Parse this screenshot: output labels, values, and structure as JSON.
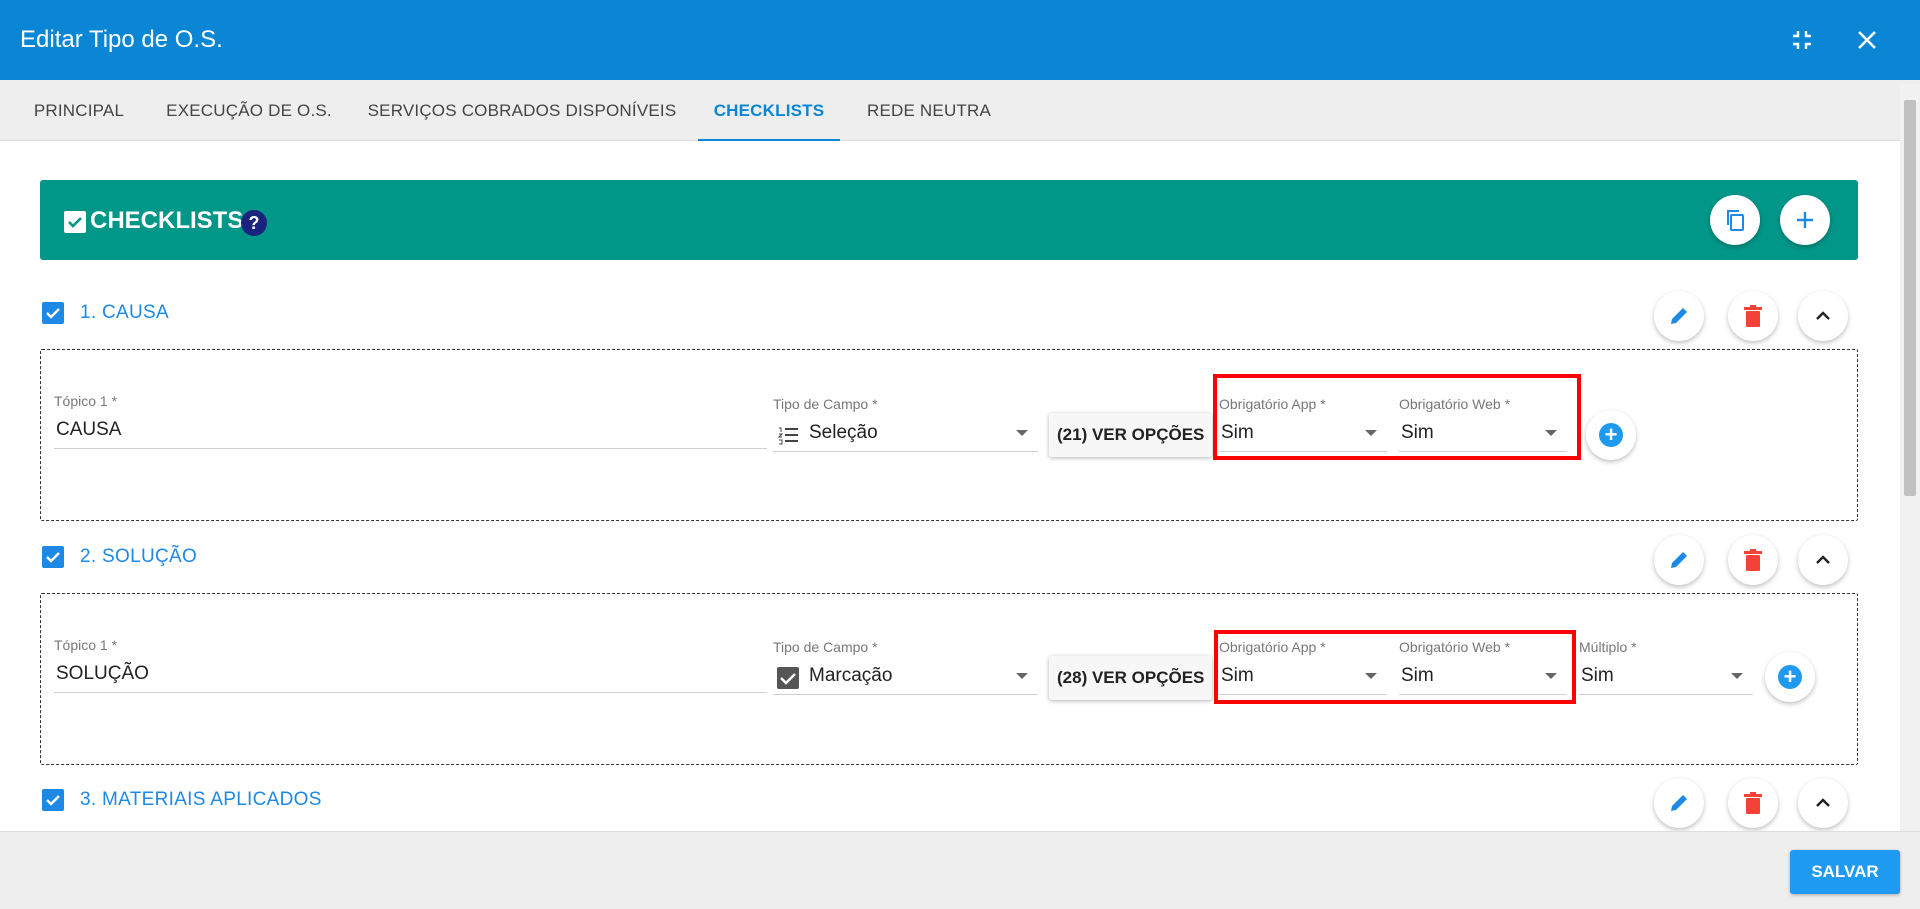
{
  "window": {
    "title": "Editar Tipo de O.S."
  },
  "tabs": [
    {
      "label": "PRINCIPAL"
    },
    {
      "label": "EXECUÇÃO DE O.S."
    },
    {
      "label": "SERVIÇOS COBRADOS DISPONÍVEIS"
    },
    {
      "label": "CHECKLISTS"
    },
    {
      "label": "REDE NEUTRA"
    }
  ],
  "active_tab": "CHECKLISTS",
  "header": {
    "title": "CHECKLISTS",
    "help": "?"
  },
  "sections": [
    {
      "label": "1. CAUSA",
      "topic_label": "Tópico 1",
      "topic_value": "CAUSA",
      "field_type_label": "Tipo de Campo",
      "field_type_value": "Seleção",
      "options_button": "(21) VER OPÇÕES",
      "app_label": "Obrigatório App",
      "app_value": "Sim",
      "web_label": "Obrigatório Web",
      "web_value": "Sim"
    },
    {
      "label": "2. SOLUÇÃO",
      "topic_label": "Tópico 1",
      "topic_value": "SOLUÇÃO",
      "field_type_label": "Tipo de Campo",
      "field_type_value": "Marcação",
      "options_button": "(28) VER OPÇÕES",
      "app_label": "Obrigatório App",
      "app_value": "Sim",
      "web_label": "Obrigatório Web",
      "web_value": "Sim",
      "multiple_label": "Múltiplo",
      "multiple_value": "Sim"
    },
    {
      "label": "3. MATERIAIS APLICADOS"
    }
  ],
  "required_mark": "*",
  "footer": {
    "save_label": "SALVAR"
  },
  "colors": {
    "title_bar": "#0a86d4",
    "header_bar": "#009688",
    "accent": "#1e88e5",
    "delete": "#f44336",
    "highlight": "#ff0000"
  }
}
